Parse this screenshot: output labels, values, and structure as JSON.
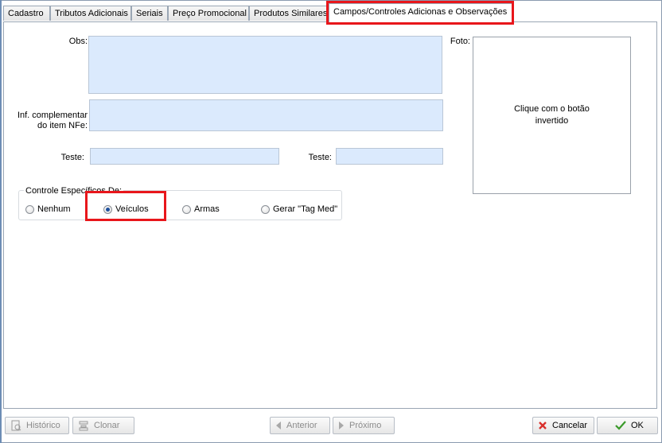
{
  "tabs": [
    {
      "label": "Cadastro"
    },
    {
      "label": "Tributos Adicionais"
    },
    {
      "label": "Seriais"
    },
    {
      "label": "Preço Promocional"
    },
    {
      "label": "Produtos Similares"
    },
    {
      "label": "Campos/Controles Adicionas e Observações"
    }
  ],
  "form": {
    "obs_label": "Obs:",
    "obs_value": "",
    "inf_label_line1": "Inf. complementar",
    "inf_label_line2": "do item NFe:",
    "inf_value": "",
    "teste1_label": "Teste:",
    "teste1_value": "",
    "teste2_label": "Teste:",
    "teste2_value": "",
    "foto_label": "Foto:",
    "foto_hint": "Clique com o botão invertido"
  },
  "controle": {
    "legend": "Controle Específicos De:",
    "options": [
      {
        "label": "Nenhum",
        "checked": false
      },
      {
        "label": "Veículos",
        "checked": true
      },
      {
        "label": "Armas",
        "checked": false
      },
      {
        "label": "Gerar \"Tag Med\"",
        "checked": false
      }
    ]
  },
  "footer": {
    "historico": "Histórico",
    "clonar": "Clonar",
    "anterior": "Anterior",
    "proximo": "Próximo",
    "cancelar": "Cancelar",
    "ok": "OK"
  },
  "colors": {
    "highlight": "#e8161b",
    "field_bg": "#dbeafd",
    "cancel_icon": "#d9302c",
    "ok_icon": "#3a9a2a"
  }
}
